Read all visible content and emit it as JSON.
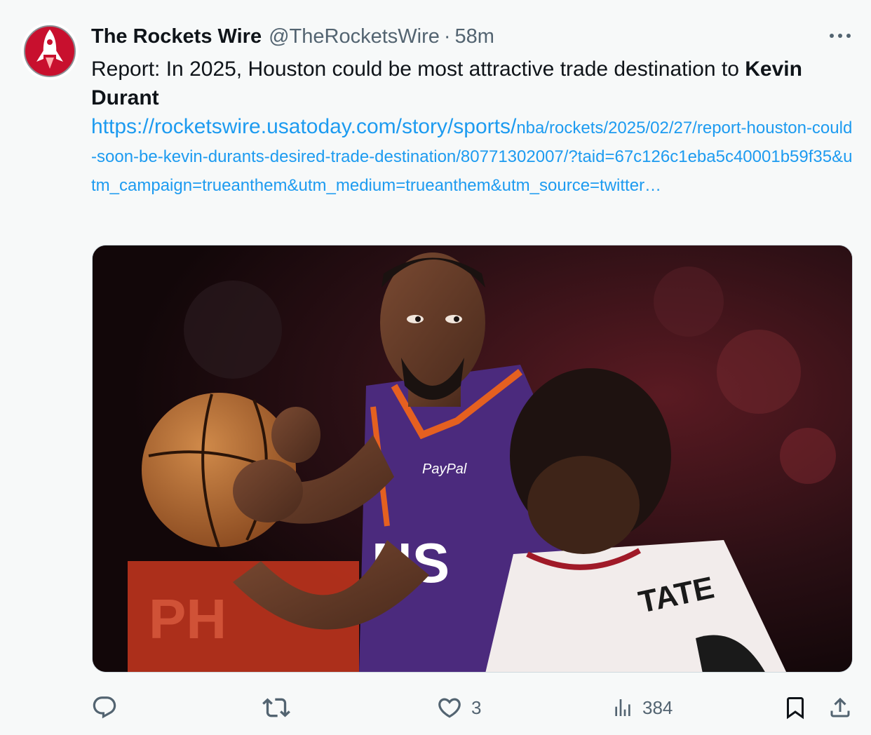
{
  "tweet": {
    "display_name": "The Rockets Wire",
    "handle": "@TheRocketsWire",
    "separator": "·",
    "time": "58m",
    "text_part1": "Report: In 2025, Houston could be most attractive trade destination to ",
    "text_bold": "Kevin Durant",
    "link_prefix": "https://rocketswire.usatoday.com/story/sports/",
    "link_rest": "nba/rockets/2025/02/27/report-houston-could-soon-be-kevin-durants-desired-trade-destination/80771302007/?taid=67c126c1eba5c40001b59f35&utm_campaign=trueanthem&utm_medium=trueanthem&utm_source=twitter…",
    "jersey_name": "TATE",
    "sponsor": "PayPal",
    "jersey_front": "NS"
  },
  "actions": {
    "reply_count": "",
    "retweet_count": "",
    "like_count": "3",
    "views_count": "384"
  },
  "icons": [
    "avatar-rocket-logo",
    "more-icon",
    "reply-icon",
    "retweet-icon",
    "like-icon",
    "views-icon",
    "bookmark-icon",
    "share-icon"
  ],
  "colors": {
    "link": "#1d9bf0",
    "muted": "#536471",
    "text": "#0f1419",
    "avatar_red": "#c8102e",
    "suns_purple": "#4b2a7d",
    "suns_orange": "#e56020"
  }
}
